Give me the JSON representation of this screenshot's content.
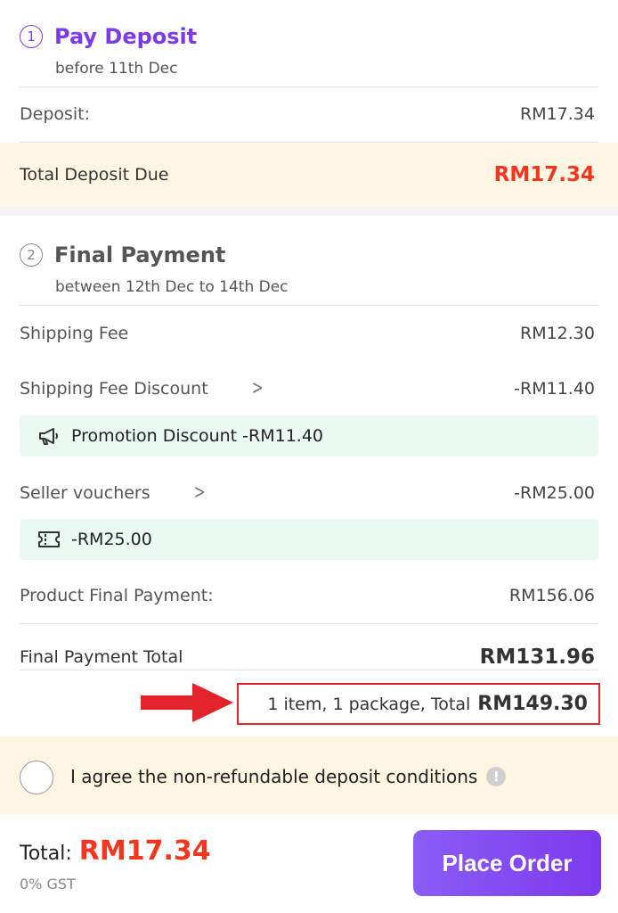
{
  "deposit_section": {
    "step": "1",
    "title": "Pay Deposit",
    "subtitle": "before 11th Dec",
    "deposit_label": "Deposit:",
    "deposit_value": "RM17.34",
    "total_label": "Total Deposit Due",
    "total_value": "RM17.34"
  },
  "final_section": {
    "step": "2",
    "title": "Final Payment",
    "subtitle": "between 12th Dec to 14th Dec",
    "shipping_fee_label": "Shipping Fee",
    "shipping_fee_value": "RM12.30",
    "shipping_discount_label": "Shipping Fee Discount",
    "shipping_discount_value": "-RM11.40",
    "promotion_text": "Promotion Discount -RM11.40",
    "seller_vouchers_label": "Seller vouchers",
    "seller_vouchers_value": "-RM25.00",
    "voucher_text": "-RM25.00",
    "product_final_label": "Product Final Payment:",
    "product_final_value": "RM156.06",
    "final_total_label": "Final Payment Total",
    "final_total_value": "RM131.96",
    "summary_text": "1 item, 1 package, Total",
    "summary_total": "RM149.30"
  },
  "agreement": {
    "text": "I agree the non-refundable deposit conditions",
    "info_icon": "!"
  },
  "footer": {
    "total_label": "Total:",
    "total_value": "RM17.34",
    "gst": "0% GST",
    "place_order": "Place Order"
  },
  "colors": {
    "accent_purple": "#7c3aed",
    "price_red": "#f4361f",
    "highlight_box": "#e2232a",
    "promo_bg": "#eafaf3",
    "deposit_band": "#fdf6e3"
  }
}
